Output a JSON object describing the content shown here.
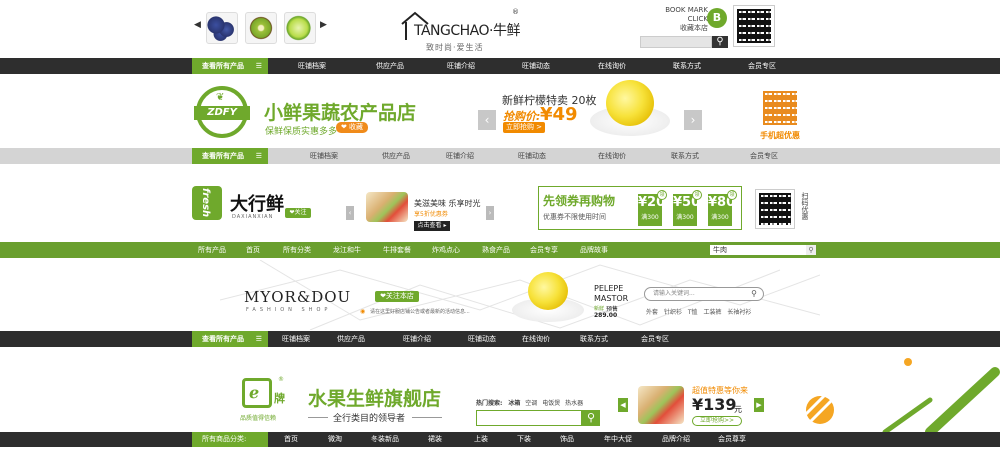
{
  "s1": {
    "brand": "TANGCHAO·牛鲜",
    "slogan": "致时尚·爱生活",
    "bookmark1": "BOOK MARK",
    "bookmark2": "CLICK",
    "bookmark3": "收藏本店",
    "badge": "B",
    "nav_all": "查看所有产品",
    "nav": [
      "旺铺档案",
      "供应产品",
      "旺铺介绍",
      "旺铺动态",
      "在线询价",
      "联系方式",
      "会员专区"
    ]
  },
  "s2": {
    "logo": "ZDFY",
    "title": "小鲜果蔬农产品店",
    "subtitle": "保鲜保质实惠多多",
    "fav": "❤ 收藏",
    "promo_title": "新鲜柠檬特卖 20枚",
    "promo_price_label": "抢购价:",
    "promo_price": "¥49",
    "promo_btn": "立即抢购 >",
    "mobile": "手机超优惠",
    "nav_all": "查看所有产品",
    "nav": [
      "旺铺档案",
      "供应产品",
      "旺铺介绍",
      "旺铺动态",
      "在线询价",
      "联系方式",
      "会员专区"
    ]
  },
  "s3": {
    "logo": "fresh",
    "name": "大行鲜",
    "pinyin": "DAXIANXIAN",
    "follow": "❤关注",
    "ad_title": "美滋美味 乐享时光",
    "ad_sub": "享5折优惠券",
    "ad_btn": "点击查看 ▸",
    "coupon_title": "先领券再购物",
    "coupon_sub": "优惠券不限使用时间",
    "coupons": [
      {
        "value": "¥20",
        "cond": "满300",
        "tag": "领"
      },
      {
        "value": "¥50",
        "cond": "满300",
        "tag": "领"
      },
      {
        "value": "¥80",
        "cond": "满300",
        "tag": "领"
      }
    ],
    "scan": "扫码优惠",
    "nav": [
      "所有产品",
      "首页",
      "所有分类",
      "龙江和牛",
      "牛排套餐",
      "炸鸡点心",
      "熟食产品",
      "会员专享",
      "品牌故事"
    ],
    "search_value": "牛肉"
  },
  "s4": {
    "brand": "MYOR&DOU",
    "brand_sub": "FASHION SHOP",
    "follow": "❤关注本店",
    "notice": "请在这里好服店铺公告或者最新的活动信息...",
    "pelepe": "PELEPE",
    "master": "MASTOR",
    "fresh_label": "新鲜",
    "pre": "预售",
    "price": "289.00",
    "search_placeholder": "请输入关键词...",
    "tags": [
      "外套",
      "针织衫",
      "T恤",
      "工装裤",
      "长袖衬衫"
    ],
    "nav_all": "查看所有产品",
    "nav": [
      "旺铺档案",
      "供应产品",
      "旺铺介绍",
      "旺铺动态",
      "在线询价",
      "联系方式",
      "会员专区"
    ]
  },
  "s5": {
    "logo_char": "牌",
    "logo_text": "品质值得信赖",
    "title": "水果生鲜旗舰店",
    "subtitle": "全行类目的领导者",
    "hot_label": "热门搜索:",
    "hot": [
      "冰箱",
      "空调",
      "电饭煲",
      "热水器"
    ],
    "promo_title": "超值特惠等你来",
    "promo_price": "¥139",
    "promo_unit": "元",
    "promo_btn": "立即抢购>>",
    "nav_all": "所有商品分类:",
    "nav": [
      "首页",
      "微淘",
      "冬装新品",
      "裙装",
      "上装",
      "下装",
      "饰品",
      "年中大促",
      "品牌介绍",
      "会员尊享"
    ]
  },
  "colors": {
    "green": "#6fa92c",
    "dark": "#2e2e2e",
    "orange": "#f18a00"
  }
}
